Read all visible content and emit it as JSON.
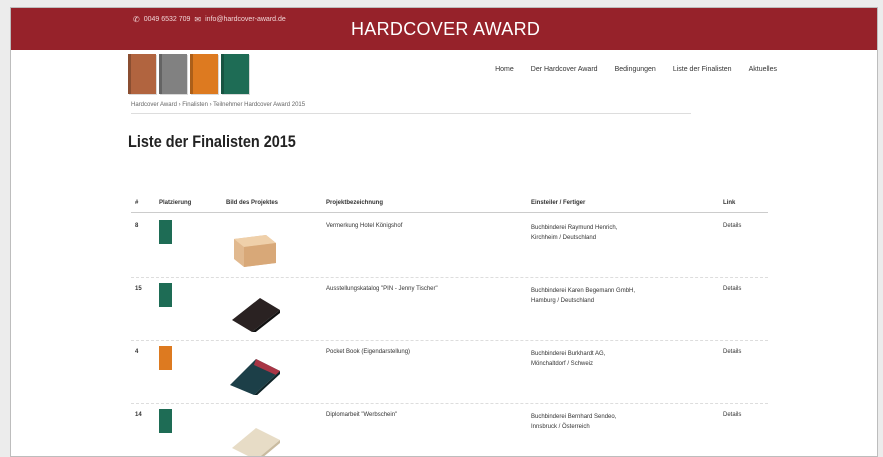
{
  "header": {
    "phone": "0049 6532 709",
    "email": "info@hardcover-award.de",
    "title": "HARDCOVER AWARD",
    "brand_color": "#96222a"
  },
  "logo": {
    "books": [
      {
        "color": "#b1643f"
      },
      {
        "color": "#818181"
      },
      {
        "color": "#dd7a20"
      },
      {
        "color": "#1e6c55"
      }
    ]
  },
  "nav": {
    "items": [
      "Home",
      "Der Hardcover Award",
      "Bedingungen",
      "Liste der Finalisten",
      "Aktuelles"
    ]
  },
  "breadcrumb": "Hardcover Award › Finalisten › Teilnehmer Hardcover Award 2015",
  "page_title": "Liste der Finalisten 2015",
  "table": {
    "headers": [
      "#",
      "Platzierung",
      "Bild des Projektes",
      "Projektbezeichnung",
      "Einsteiler / Fertiger",
      "Link"
    ],
    "rows": [
      {
        "num": "8",
        "badge_color": "#1e6c55",
        "name": "Vermerkung Hotel Königshof",
        "entrant_line1": "Buchbinderei Raymund Henrich,",
        "entrant_line2": "Kirchheim / Deutschland",
        "link": "Details",
        "image": "box-tan"
      },
      {
        "num": "15",
        "badge_color": "#1e6c55",
        "name": "Ausstellungskatalog \"PIN - Jenny Tischer\"",
        "entrant_line1": "Buchbinderei Karen Begemann GmbH,",
        "entrant_line2": "Hamburg / Deutschland",
        "link": "Details",
        "image": "book-black"
      },
      {
        "num": "4",
        "badge_color": "#dd7a20",
        "name": "Pocket Book (Eigendarstellung)",
        "entrant_line1": "Buchbinderei Burkhardt AG,",
        "entrant_line2": "Mönchaltdorf / Schweiz",
        "link": "Details",
        "image": "book-teal"
      },
      {
        "num": "14",
        "badge_color": "#1e6c55",
        "name": "Diplomarbeit \"Werbschein\"",
        "entrant_line1": "Buchbinderei Bernhard Sendeo,",
        "entrant_line2": "Innsbruck / Österreich",
        "link": "Details",
        "image": "book-beige"
      }
    ]
  }
}
